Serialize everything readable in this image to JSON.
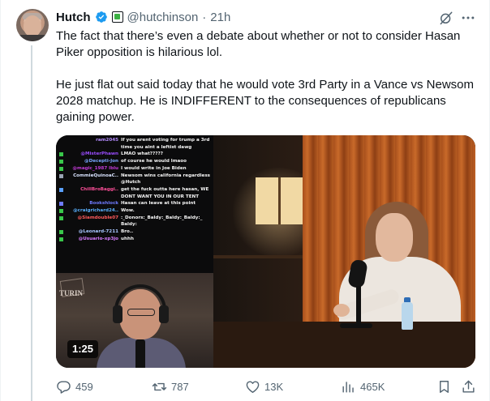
{
  "author": {
    "display_name": "Hutch",
    "handle": "@hutchinson",
    "separator": "·",
    "time": "21h"
  },
  "tweet": {
    "paragraph_1": "The fact that there’s even a debate about whether or not to consider Hasan Piker opposition is hilarious lol.",
    "paragraph_2": "He just flat out said today that he would vote 3rd Party in a Vance vs Newsom 2028 matchup. He is INDIFFERENT to the consequences of republicans gaining power."
  },
  "media": {
    "duration": "1:25",
    "sign_text": "TURIN",
    "chat": [
      {
        "user": "ram2045",
        "msg": "If you arent voting for trump a 3rd",
        "color": "#b58cff",
        "badge": ""
      },
      {
        "user": "",
        "msg": "time you aint a leftist dawg",
        "color": "#b58cff",
        "badge": ""
      },
      {
        "user": "@MisterPhawn",
        "msg": "LMAO what?????",
        "color": "#9a4cff",
        "badge": "#39c74a"
      },
      {
        "user": "@Decepti-Jon",
        "msg": "of course he would lmaoo",
        "color": "#7aa6ff",
        "badge": "#39c74a"
      },
      {
        "user": "@magic_1987 lblu",
        "msg": "I would write in Joe Biden",
        "color": "#c23bd6",
        "badge": "#39c74a"
      },
      {
        "user": "CommieQuinoaC..",
        "msg": "Newsom wins california regardless",
        "color": "#d9e4ff",
        "badge": "#9aa4b3"
      },
      {
        "user": "",
        "msg": "@Hutch",
        "color": "#d9e4ff",
        "badge": ""
      },
      {
        "user": "ChillBroBaggi..",
        "msg": "get the fuck outta here hasan, WE",
        "color": "#ff4f9a",
        "badge": "#5aa0ff"
      },
      {
        "user": "",
        "msg": "DONT WANT YOU IN OUR TENT",
        "color": "#ff4f9a",
        "badge": ""
      },
      {
        "user": "Bookshlock",
        "msg": "Hasan can leave at this point",
        "color": "#6f7bff",
        "badge": "#6f7bff"
      },
      {
        "user": "@craigrichard24..",
        "msg": "Wow.",
        "color": "#5ab1ff",
        "badge": "#39c74a"
      },
      {
        "user": "@Siamdouble07",
        "msg": ":_Donors:_Baldy:_Baldy:_Baldy:_",
        "color": "#ff5a5a",
        "badge": "#39c74a"
      },
      {
        "user": "",
        "msg": "Baldy:",
        "color": "#ff5a5a",
        "badge": ""
      },
      {
        "user": "@Leonard-7211",
        "msg": "Bro..",
        "color": "#a8c6ff",
        "badge": "#39c74a"
      },
      {
        "user": "@Usuario-xp3jo",
        "msg": "uhhh",
        "color": "#d87cff",
        "badge": "#39c74a"
      }
    ]
  },
  "actions": {
    "replies": "459",
    "reposts": "787",
    "likes": "13K",
    "views": "465K"
  },
  "colors": {
    "verified": "#1d9bf0",
    "secondary_text": "#536471",
    "primary_text": "#0f1419"
  }
}
